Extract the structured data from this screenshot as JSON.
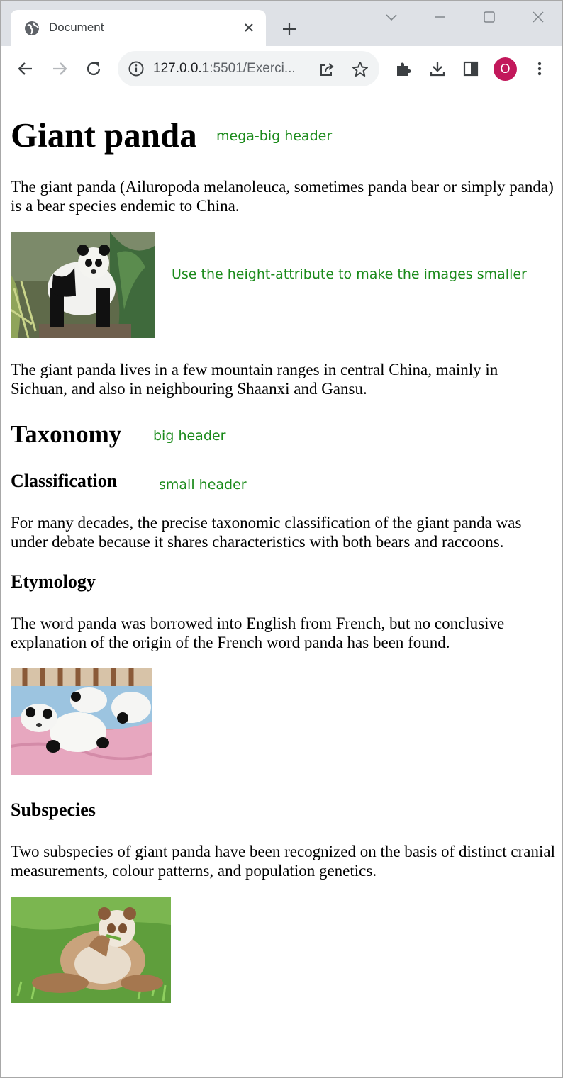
{
  "browser": {
    "tab_title": "Document",
    "url_host": "127.0.0.1",
    "url_rest": ":5501/Exerci...",
    "profile_initial": "O"
  },
  "page": {
    "title": "Giant panda",
    "title_note": "mega-big header",
    "intro": "The giant panda (Ailuropoda melanoleuca, sometimes panda bear or simply panda) is a bear species endemic to China.",
    "image_note": "Use the height-attribute to make the images smaller",
    "habitat": "The giant panda lives in a few mountain ranges in central China, mainly in Sichuan, and also in neighbouring Shaanxi and Gansu.",
    "taxonomy_heading": "Taxonomy",
    "taxonomy_note": "big header",
    "classification_heading": "Classification",
    "classification_note": "small header",
    "classification_text": "For many decades, the precise taxonomic classification of the giant panda was under debate because it shares characteristics with both bears and raccoons.",
    "etymology_heading": "Etymology",
    "etymology_text": "The word panda was borrowed into English from French, but no conclusive explanation of the origin of the French word panda has been found.",
    "subspecies_heading": "Subspecies",
    "subspecies_text": "Two subspecies of giant panda have been recognized on the basis of distinct cranial measurements, colour patterns, and population genetics."
  },
  "colors": {
    "note_green": "#1a8a1a",
    "tabstrip": "#dee1e6",
    "profile": "#c2185b"
  }
}
